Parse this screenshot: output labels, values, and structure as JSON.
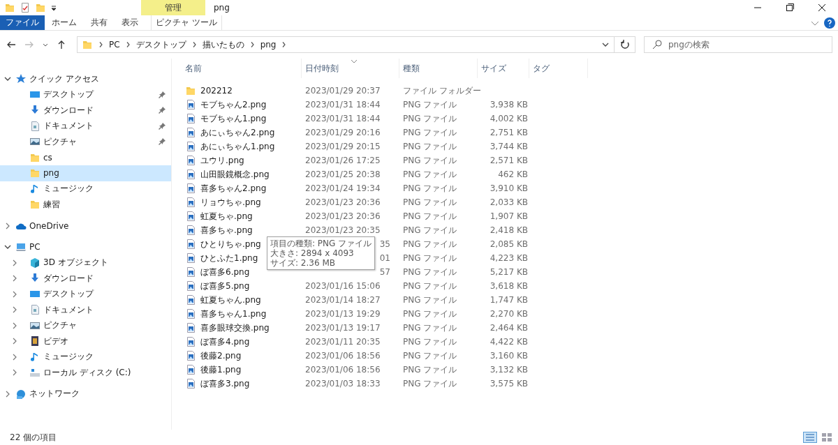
{
  "window": {
    "title": "png",
    "context_tab": "管理"
  },
  "ribbon_tabs": [
    {
      "label": "ファイル",
      "kind": "file",
      "selected": false
    },
    {
      "label": "ホーム",
      "kind": "tab",
      "selected": false
    },
    {
      "label": "共有",
      "kind": "tab",
      "selected": false
    },
    {
      "label": "表示",
      "kind": "tab",
      "selected": false
    },
    {
      "label": "ピクチャ ツール",
      "kind": "context",
      "selected": false
    }
  ],
  "address_bar": {
    "path": [
      "PC",
      "デスクトップ",
      "描いたもの",
      "png"
    ]
  },
  "search": {
    "placeholder": "pngの検索"
  },
  "sidebar": {
    "items": [
      {
        "label": "クイック アクセス",
        "kind": "star",
        "expanded": true,
        "children": [
          {
            "label": "デスクトップ",
            "kind": "desktop",
            "pinned": true,
            "selected": false
          },
          {
            "label": "ダウンロード",
            "kind": "download",
            "pinned": true,
            "selected": false
          },
          {
            "label": "ドキュメント",
            "kind": "document",
            "pinned": true,
            "selected": false
          },
          {
            "label": "ピクチャ",
            "kind": "pictures",
            "pinned": true,
            "selected": false
          },
          {
            "label": "cs",
            "kind": "folder",
            "pinned": false,
            "selected": false
          },
          {
            "label": "png",
            "kind": "folder",
            "pinned": false,
            "selected": true
          },
          {
            "label": "ミュージック",
            "kind": "music",
            "pinned": false,
            "selected": false
          },
          {
            "label": "練習",
            "kind": "folder",
            "pinned": false,
            "selected": false
          }
        ]
      },
      {
        "label": "OneDrive",
        "kind": "cloud",
        "expanded": false
      },
      {
        "label": "PC",
        "kind": "pc",
        "expanded": true,
        "children": [
          {
            "label": "3D オブジェクト",
            "kind": "cube",
            "expanded": false
          },
          {
            "label": "ダウンロード",
            "kind": "download",
            "expanded": false
          },
          {
            "label": "デスクトップ",
            "kind": "desktop",
            "expanded": false
          },
          {
            "label": "ドキュメント",
            "kind": "document",
            "expanded": false
          },
          {
            "label": "ピクチャ",
            "kind": "pictures",
            "expanded": false
          },
          {
            "label": "ビデオ",
            "kind": "video",
            "expanded": false
          },
          {
            "label": "ミュージック",
            "kind": "music",
            "expanded": false
          },
          {
            "label": "ローカル ディスク (C:)",
            "kind": "drive",
            "expanded": false
          }
        ]
      },
      {
        "label": "ネットワーク",
        "kind": "network",
        "expanded": false
      }
    ]
  },
  "table": {
    "columns": [
      "名前",
      "日付時刻",
      "種類",
      "サイズ",
      "タグ"
    ],
    "rows": [
      {
        "kind": "folder",
        "name": "202212",
        "date": "2023/01/29 20:37",
        "type": "ファイル フォルダー"
      },
      {
        "kind": "image",
        "name": "モブちゃん2.png",
        "date": "2023/01/31 18:44",
        "type": "PNG ファイル",
        "size": "3,938 KB"
      },
      {
        "kind": "image",
        "name": "モブちゃん1.png",
        "date": "2023/01/31 18:44",
        "type": "PNG ファイル",
        "size": "4,002 KB"
      },
      {
        "kind": "image",
        "name": "あにぃちゃん2.png",
        "date": "2023/01/29 20:16",
        "type": "PNG ファイル",
        "size": "2,751 KB"
      },
      {
        "kind": "image",
        "name": "あにぃちゃん1.png",
        "date": "2023/01/29 20:15",
        "type": "PNG ファイル",
        "size": "3,744 KB"
      },
      {
        "kind": "image",
        "name": "ユウリ.png",
        "date": "2023/01/26 17:25",
        "type": "PNG ファイル",
        "size": "2,571 KB"
      },
      {
        "kind": "image",
        "name": "山田眼鏡概念.png",
        "date": "2023/01/25 20:38",
        "type": "PNG ファイル",
        "size": "462 KB"
      },
      {
        "kind": "image",
        "name": "喜多ちゃん2.png",
        "date": "2023/01/24 19:34",
        "type": "PNG ファイル",
        "size": "3,910 KB"
      },
      {
        "kind": "image",
        "name": "リョウちゃ.png",
        "date": "2023/01/23 20:36",
        "type": "PNG ファイル",
        "size": "2,033 KB"
      },
      {
        "kind": "image",
        "name": "虹夏ちゃ.png",
        "date": "2023/01/23 20:36",
        "type": "PNG ファイル",
        "size": "1,907 KB"
      },
      {
        "kind": "image",
        "name": "喜多ちゃ.png",
        "date": "2023/01/23 20:35",
        "type": "PNG ファイル",
        "size": "2,418 KB"
      },
      {
        "kind": "image",
        "name": "ひとりちゃ.png",
        "date_tail": "35",
        "type": "PNG ファイル",
        "size": "2,085 KB"
      },
      {
        "kind": "image",
        "name": "ひとふた1.png",
        "date_tail": "01",
        "type": "PNG ファイル",
        "size": "4,223 KB"
      },
      {
        "kind": "image",
        "name": "ぼ喜多6.png",
        "date_tail": "57",
        "type": "PNG ファイル",
        "size": "5,217 KB"
      },
      {
        "kind": "image",
        "name": "ぼ喜多5.png",
        "date": "2023/01/16 15:06",
        "type": "PNG ファイル",
        "size": "3,618 KB"
      },
      {
        "kind": "image",
        "name": "虹夏ちゃん.png",
        "date": "2023/01/14 18:27",
        "type": "PNG ファイル",
        "size": "1,747 KB"
      },
      {
        "kind": "image",
        "name": "喜多ちゃん1.png",
        "date": "2023/01/13 19:29",
        "type": "PNG ファイル",
        "size": "2,270 KB"
      },
      {
        "kind": "image",
        "name": "喜多眼球交換.png",
        "date": "2023/01/13 19:17",
        "type": "PNG ファイル",
        "size": "2,464 KB"
      },
      {
        "kind": "image",
        "name": "ぼ喜多4.png",
        "date": "2023/01/11 20:35",
        "type": "PNG ファイル",
        "size": "4,422 KB"
      },
      {
        "kind": "image",
        "name": "後藤2.png",
        "date": "2023/01/06 18:56",
        "type": "PNG ファイル",
        "size": "3,160 KB"
      },
      {
        "kind": "image",
        "name": "後藤1.png",
        "date": "2023/01/06 18:56",
        "type": "PNG ファイル",
        "size": "3,132 KB"
      },
      {
        "kind": "image",
        "name": "ぼ喜多3.png",
        "date": "2023/01/03 18:33",
        "type": "PNG ファイル",
        "size": "3,575 KB"
      }
    ]
  },
  "tooltip": {
    "lines": [
      "項目の種類: PNG ファイル",
      "大きさ: 2894 x 4093",
      "サイズ: 2.36 MB"
    ]
  },
  "status_bar": {
    "count": "22 個の項目",
    "view_buttons": [
      {
        "kind": "details",
        "selected": true
      },
      {
        "kind": "icons",
        "selected": false
      }
    ]
  }
}
